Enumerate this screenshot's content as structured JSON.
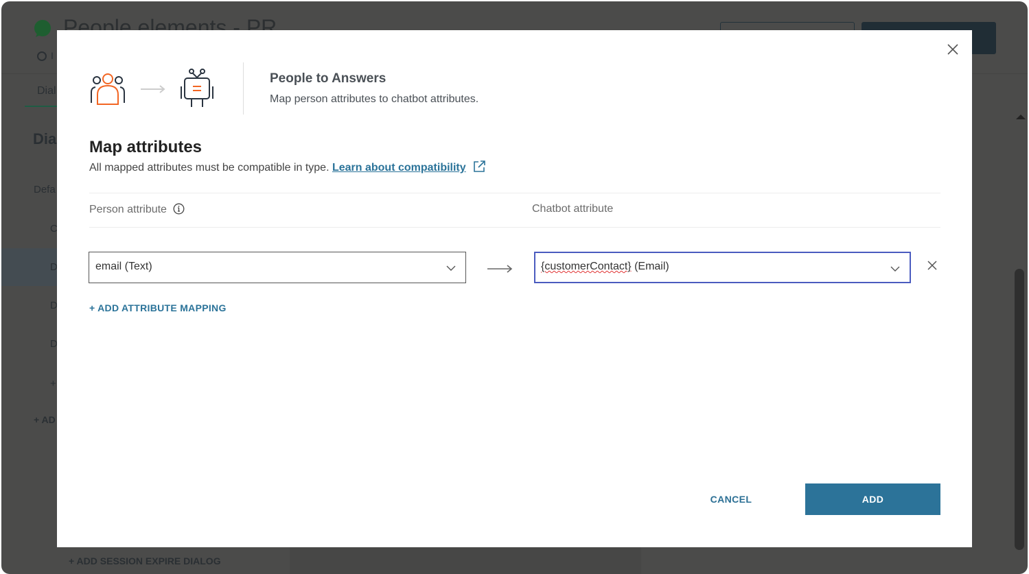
{
  "background": {
    "page_title": "People elements - PR",
    "status_fragment": "I",
    "tab_fragment": "Dial",
    "heading_fragment": "Dia",
    "default_fragment": "Defa",
    "list_fragments": [
      "C",
      "D",
      "D",
      "D",
      "+"
    ],
    "add_fragment": "+ AD",
    "add_session_expire": "+ ADD SESSION EXPIRE DIALOG"
  },
  "modal": {
    "header_title": "People to Answers",
    "header_subtitle": "Map person attributes to chatbot attributes.",
    "section_title": "Map attributes",
    "section_description": "All mapped attributes must be compatible in type.",
    "learn_link": "Learn about compatibility",
    "columns": {
      "person": "Person attribute",
      "chatbot": "Chatbot attribute"
    },
    "mappings": [
      {
        "person_value": "email (Text)",
        "chatbot_value_name": "{customerContact}",
        "chatbot_value_type": " (Email)"
      }
    ],
    "add_mapping": "+ ADD ATTRIBUTE MAPPING",
    "cancel": "CANCEL",
    "add": "ADD"
  },
  "colors": {
    "accent": "#2c7399",
    "orange": "#f26522",
    "focus_border": "#4a5bbf",
    "backdrop": "#4b4b4a"
  }
}
